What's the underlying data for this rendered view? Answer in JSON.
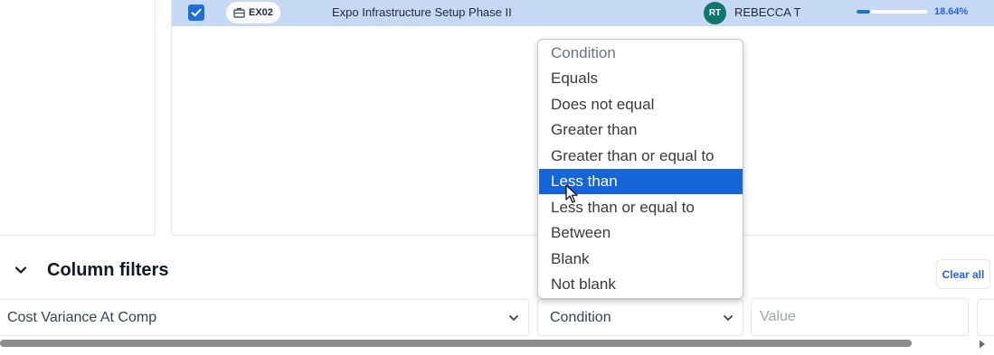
{
  "grid": {
    "row": {
      "checked": true,
      "code": "EX02",
      "name": "Expo Infrastructure Setup Phase II",
      "owner_initials": "RT",
      "owner_name": "REBECCA T",
      "progress_pct": 18.64,
      "progress_label": "18.64%"
    }
  },
  "filters": {
    "title": "Column filters",
    "clear_all_label": "Clear all",
    "column_select_value": "Cost Variance At Comp",
    "condition_select_value": "Condition",
    "value_placeholder": "Value"
  },
  "dropdown": {
    "header": "Condition",
    "options": [
      "Equals",
      "Does not equal",
      "Greater than",
      "Greater than or equal to",
      "Less than",
      "Less than or equal to",
      "Between",
      "Blank",
      "Not blank"
    ],
    "selected": "Less than"
  },
  "colors": {
    "selection_row": "#c6d9f4",
    "accent": "#1e6fd9",
    "avatar": "#0f766e",
    "highlight": "#1565d8"
  },
  "icons": {
    "checkbox": "check-icon",
    "code_chip": "briefcase-icon",
    "collapse": "chevron-down-icon",
    "select": "chevron-down-icon",
    "scroll": "arrow-right-icon",
    "pointer": "mouse-cursor-icon"
  }
}
